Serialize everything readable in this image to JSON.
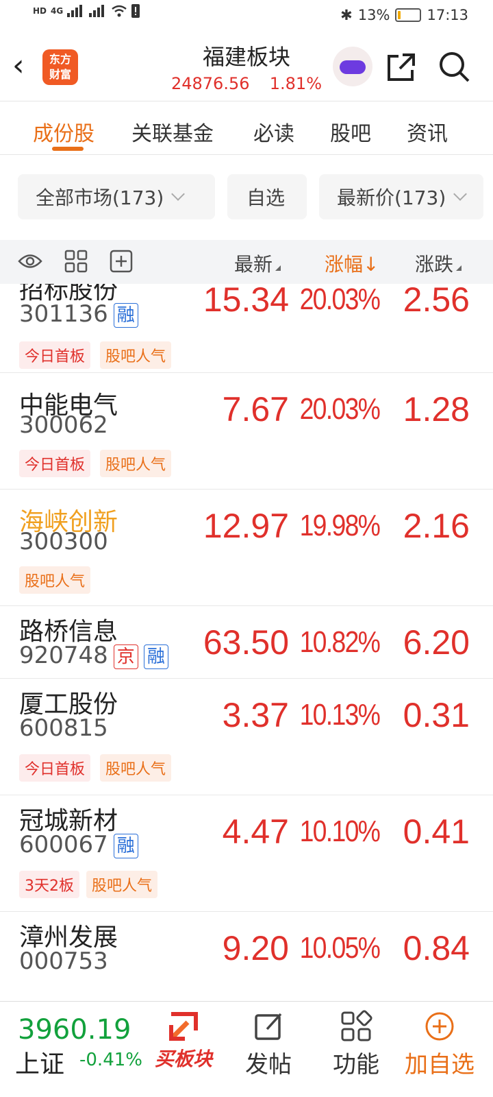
{
  "status_bar": {
    "signal_label": "HD",
    "network": "4G",
    "bluetooth": "✱",
    "battery": "13%",
    "battery_level": 0.13,
    "time": "17:13"
  },
  "header": {
    "logo_text": "东方财富",
    "title": "福建板块",
    "index_value": "24876.56",
    "index_change": "1.81%"
  },
  "tabs": [
    {
      "label": "成份股",
      "active": true
    },
    {
      "label": "关联基金",
      "active": false
    },
    {
      "label": "必读",
      "active": false
    },
    {
      "label": "股吧",
      "active": false
    },
    {
      "label": "资讯",
      "active": false
    }
  ],
  "filters": {
    "market": "全部市场(173)",
    "watchlist": "自选",
    "sort": "最新价(173)"
  },
  "columns": {
    "latest": "最新",
    "change_pct": "涨幅↓",
    "change": "涨跌"
  },
  "rows": [
    {
      "name": "招标股份",
      "code": "301136",
      "badges": [
        "融"
      ],
      "tags": [
        "今日首板",
        "股吧人气"
      ],
      "latest": "15.34",
      "pct": "20.03%",
      "chg": "2.56"
    },
    {
      "name": "中能电气",
      "code": "300062",
      "badges": [],
      "tags": [
        "今日首板",
        "股吧人气"
      ],
      "latest": "7.67",
      "pct": "20.03%",
      "chg": "1.28"
    },
    {
      "name": "海峡创新",
      "code": "300300",
      "badges": [],
      "tags": [
        "股吧人气"
      ],
      "latest": "12.97",
      "pct": "19.98%",
      "chg": "2.16"
    },
    {
      "name": "路桥信息",
      "code": "920748",
      "badges": [
        "京",
        "融"
      ],
      "tags": [],
      "latest": "63.50",
      "pct": "10.82%",
      "chg": "6.20"
    },
    {
      "name": "厦工股份",
      "code": "600815",
      "badges": [],
      "tags": [
        "今日首板",
        "股吧人气"
      ],
      "latest": "3.37",
      "pct": "10.13%",
      "chg": "0.31"
    },
    {
      "name": "冠城新材",
      "code": "600067",
      "badges": [
        "融"
      ],
      "tags": [
        "3天2板",
        "股吧人气"
      ],
      "latest": "4.47",
      "pct": "10.10%",
      "chg": "0.41"
    },
    {
      "name": "漳州发展",
      "code": "000753",
      "badges": [],
      "tags": [],
      "latest": "9.20",
      "pct": "10.05%",
      "chg": "0.84"
    }
  ],
  "bottom": {
    "index_value": "3960.19",
    "index_name": "上证",
    "index_pct": "-0.41%",
    "buy": "买板块",
    "post": "发帖",
    "func": "功能",
    "add": "加自选"
  },
  "colors": {
    "up": "#e0302b",
    "down": "#12a13c",
    "accent": "#e96f18"
  }
}
